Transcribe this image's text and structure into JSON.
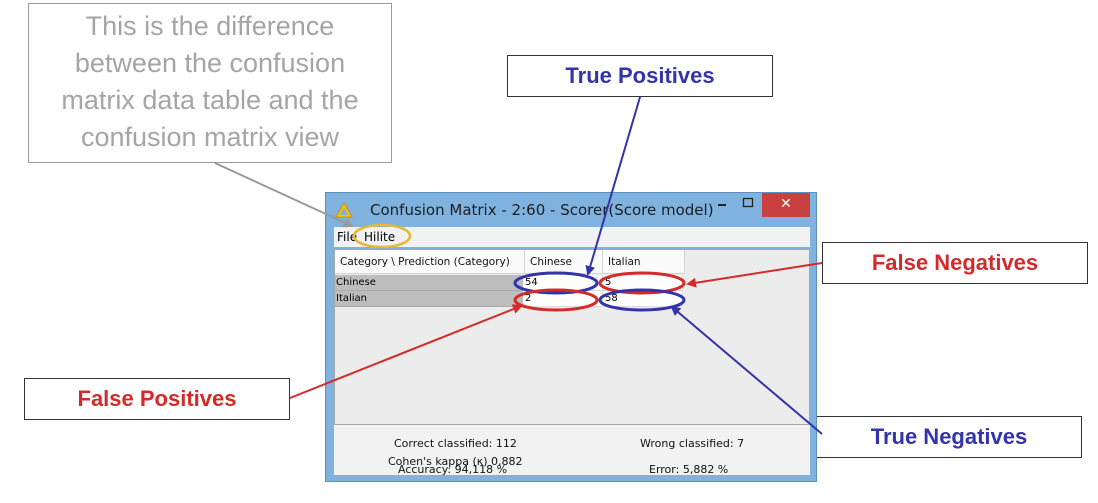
{
  "note": {
    "lines": [
      "This is the difference",
      "between the confusion",
      "matrix data table and the",
      "confusion matrix view"
    ]
  },
  "annotations": {
    "true_positives": "True Positives",
    "false_negatives": "False Negatives",
    "false_positives": "False Positives",
    "true_negatives": "True Negatives"
  },
  "window": {
    "title": "Confusion Matrix - 2:60 - Scorer(Score model)",
    "menu": {
      "file": "File",
      "hilite": "Hilite"
    },
    "table": {
      "corner_header": "Category \\ Prediction (Category)",
      "col_headers": [
        "Chinese",
        "Italian"
      ],
      "rows": [
        {
          "label": "Chinese",
          "values": [
            "54",
            "5"
          ]
        },
        {
          "label": "Italian",
          "values": [
            "2",
            "58"
          ]
        }
      ]
    },
    "stats": {
      "correct": "Correct classified: 112",
      "wrong": "Wrong classified: 7",
      "accuracy": "Accuracy: 94,118 %",
      "error": "Error: 5,882 %",
      "kappa": "Cohen's kappa (κ) 0,882"
    }
  },
  "colors": {
    "blue": "#3333aa",
    "red": "#d42a2a",
    "hilite_ring": "#e8b830",
    "window_frame": "#7fb2df"
  }
}
